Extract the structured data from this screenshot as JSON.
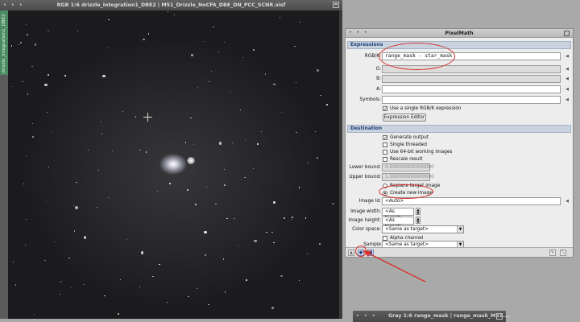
{
  "image_window": {
    "title": "RGB 1:6 drizzle_integration1_DBE2 | M51_Drizzle_NoCFA_DBE_DN_PCC_SCNR.xisf",
    "side_tab": "drizzle_integration1_DBE2",
    "title_dots": "• • •"
  },
  "pixelmath": {
    "title": "PixelMath",
    "title_dots": "• • •",
    "expressions_header": "Expressions",
    "rgbk_label": "RGB/K:",
    "rgbk_value": "range_mask - star_mask",
    "g_label": "G:",
    "b_label": "B:",
    "a_label": "A:",
    "symbols_label": "Symbols:",
    "use_single_label": "Use a single RGB/K expression",
    "use_single_checked": "✓",
    "expression_editor_label": "Expression Editor",
    "destination_header": "Destination",
    "generate_output_label": "Generate output",
    "generate_output_checked": "✓",
    "single_threaded_label": "Single threaded",
    "use64_label": "Use 64-bit working images",
    "rescale_label": "Rescale result",
    "lower_bound_label": "Lower bound:",
    "lower_bound_value": "0.000000000000000",
    "upper_bound_label": "Upper bound:",
    "upper_bound_value": "1.000000000000000",
    "replace_target_label": "Replace target image",
    "create_new_label": "Create new image",
    "image_id_label": "Image Id:",
    "image_id_value": "<Auto>",
    "image_width_label": "Image width:",
    "image_width_value": "<As target>",
    "image_height_label": "Image height:",
    "image_height_value": "<As target>",
    "color_space_label": "Color space:",
    "color_space_value": "<Same as target>",
    "alpha_channel_label": "Alpha channel",
    "sample_format_label": "Sample format:",
    "sample_format_value": "<Same as target>"
  },
  "gray_window": {
    "title": "Gray 1:6 range_mask | range_mask_M51....",
    "title_dots": "• • •"
  },
  "colors": {
    "annotation_red": "#d8322c",
    "section_header_text": "#1f3f7a",
    "side_tab_green": "#4a8a62"
  }
}
